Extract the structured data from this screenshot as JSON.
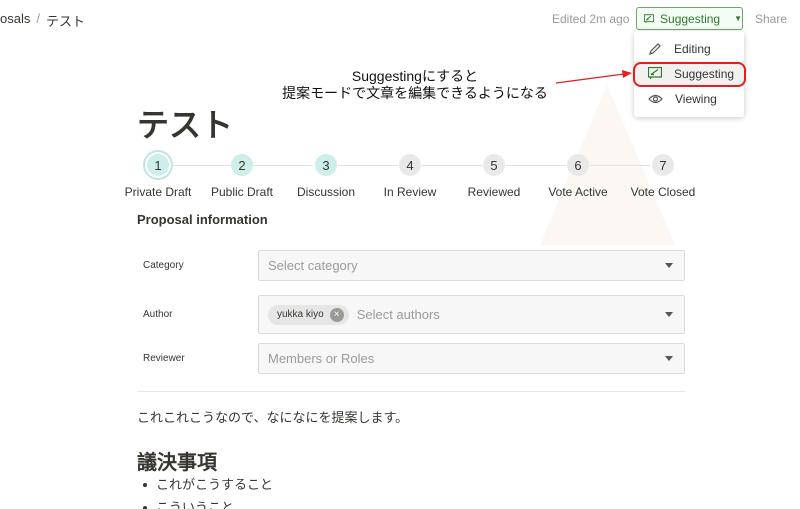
{
  "breadcrumb": {
    "parent": "osals",
    "separator": "/",
    "current": "テスト"
  },
  "header": {
    "edited": "Edited 2m ago",
    "mode_label": "Suggesting",
    "share": "Share"
  },
  "mode_menu": {
    "items": [
      {
        "label": "Editing",
        "icon": "pencil-icon"
      },
      {
        "label": "Suggesting",
        "icon": "suggest-icon"
      },
      {
        "label": "Viewing",
        "icon": "eye-icon"
      }
    ]
  },
  "annotation": {
    "line1": "Suggestingにすると",
    "line2": "提案モードで文章を編集できるようになる",
    "color": "#e02020"
  },
  "page": {
    "title": "テスト"
  },
  "steps": [
    {
      "num": "1",
      "label": "Private Draft",
      "state": "active"
    },
    {
      "num": "2",
      "label": "Public Draft",
      "state": "done"
    },
    {
      "num": "3",
      "label": "Discussion",
      "state": "done"
    },
    {
      "num": "4",
      "label": "In Review",
      "state": "todo"
    },
    {
      "num": "5",
      "label": "Reviewed",
      "state": "todo"
    },
    {
      "num": "6",
      "label": "Vote Active",
      "state": "todo"
    },
    {
      "num": "7",
      "label": "Vote Closed",
      "state": "todo"
    }
  ],
  "proposal": {
    "section_title": "Proposal information",
    "category": {
      "label": "Category",
      "placeholder": "Select category"
    },
    "author": {
      "label": "Author",
      "chip": "yukka kiyo",
      "placeholder": "Select authors"
    },
    "reviewer": {
      "label": "Reviewer",
      "placeholder": "Members or Roles"
    }
  },
  "content": {
    "paragraph": "これこれこうなので、なになにを提案します。",
    "heading": "議決事項",
    "bullets": [
      "これがこうすること",
      "こういうこと"
    ]
  },
  "colors": {
    "accent_green": "#2d7a2d",
    "step_done": "#cdeee9",
    "step_todo": "#e9e9e9"
  }
}
